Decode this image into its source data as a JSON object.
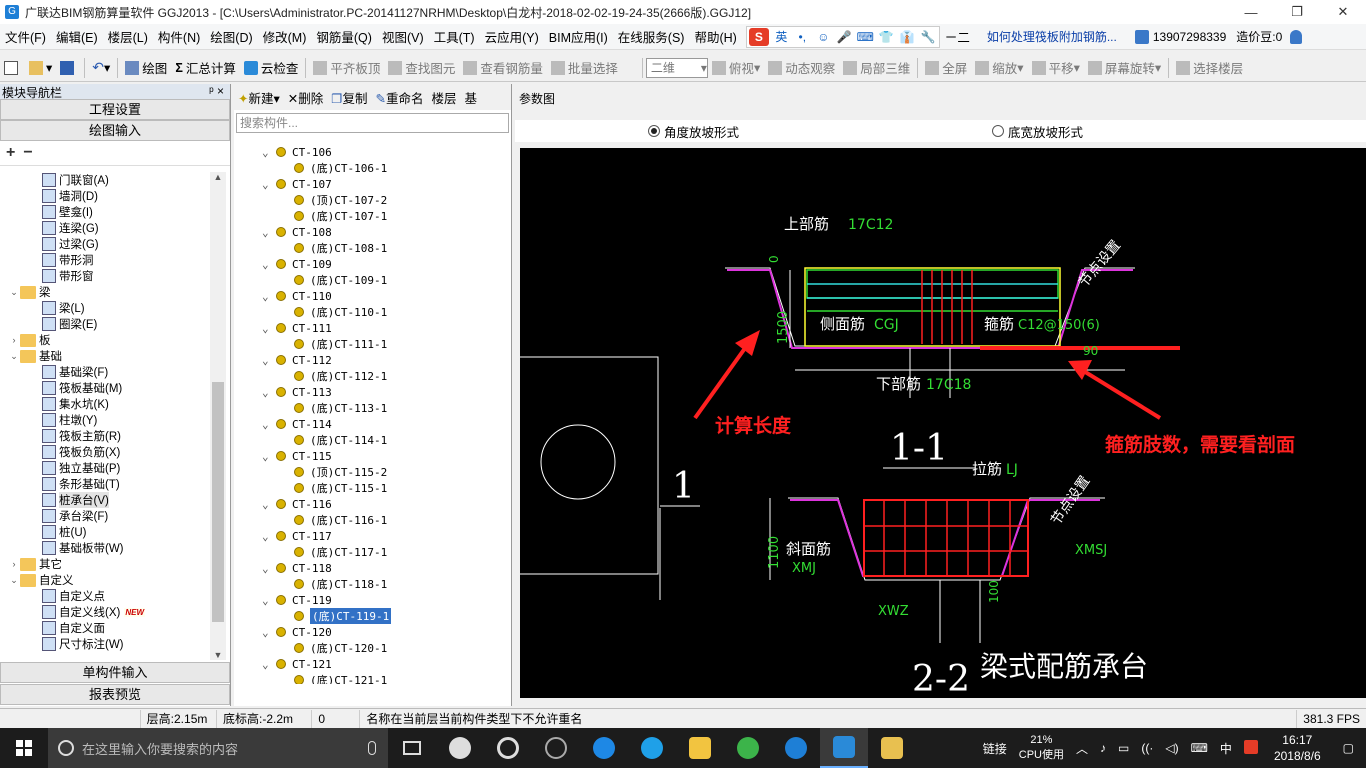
{
  "window": {
    "title": "广联达BIM钢筋算量软件 GGJ2013 - [C:\\Users\\Administrator.PC-20141127NRHM\\Desktop\\白龙村-2018-02-02-19-24-35(2666版).GGJ12]",
    "minimize": "—",
    "maximize": "❐",
    "close": "✕"
  },
  "menu": {
    "items": [
      "文件(F)",
      "编辑(E)",
      "楼层(L)",
      "构件(N)",
      "绘图(D)",
      "修改(M)",
      "钢筋量(Q)",
      "视图(V)",
      "工具(T)",
      "云应用(Y)",
      "BIM应用(I)",
      "在线服务(S)",
      "帮助(H)"
    ],
    "ime": [
      "S",
      "英",
      "•,",
      "☺",
      "🎤",
      "⌨",
      "👕",
      "👔",
      "🔧"
    ],
    "ime_tail": "ㄧ二",
    "help_link": "如何处理筏板附加钢筋...",
    "phone": "13907298339",
    "beans": "造价豆:0"
  },
  "toolbar": {
    "items": [
      {
        "label": "绘图",
        "icon": "draw-icon",
        "enabled": true
      },
      {
        "label": "汇总计算",
        "icon": "sigma-icon",
        "enabled": true
      },
      {
        "label": "云检查",
        "icon": "cloud-check-icon",
        "enabled": true
      },
      {
        "label": "平齐板顶",
        "icon": "align-top-icon",
        "enabled": false
      },
      {
        "label": "查找图元",
        "icon": "find-icon",
        "enabled": false
      },
      {
        "label": "查看钢筋量",
        "icon": "rebar-icon",
        "enabled": false
      },
      {
        "label": "批量选择",
        "icon": "batch-select-icon",
        "enabled": false
      }
    ],
    "view_mode": "二维",
    "view_items": [
      {
        "label": "俯视",
        "icon": "top-view-icon"
      },
      {
        "label": "动态观察",
        "icon": "orbit-icon"
      },
      {
        "label": "局部三维",
        "icon": "local-3d-icon"
      },
      {
        "label": "全屏",
        "icon": "fullscreen-icon"
      },
      {
        "label": "缩放",
        "icon": "zoom-icon"
      },
      {
        "label": "平移",
        "icon": "pan-icon"
      },
      {
        "label": "屏幕旋转",
        "icon": "rotate-icon"
      },
      {
        "label": "选择楼层",
        "icon": "floor-select-icon"
      }
    ]
  },
  "nav": {
    "title": "模块导航栏",
    "pin": "ᵖ ×",
    "btn_project": "工程设置",
    "btn_draw": "绘图输入",
    "expand_all": "+",
    "collapse_all": "−",
    "tree": [
      {
        "label": "门联窗(A)",
        "level": 2,
        "type": "item"
      },
      {
        "label": "墙洞(D)",
        "level": 2,
        "type": "item"
      },
      {
        "label": "壁龛(I)",
        "level": 2,
        "type": "item"
      },
      {
        "label": "连梁(G)",
        "level": 2,
        "type": "item"
      },
      {
        "label": "过梁(G)",
        "level": 2,
        "type": "item"
      },
      {
        "label": "带形洞",
        "level": 2,
        "type": "item"
      },
      {
        "label": "带形窗",
        "level": 2,
        "type": "item"
      },
      {
        "label": "梁",
        "level": 1,
        "type": "folder",
        "exp": "⌄"
      },
      {
        "label": "梁(L)",
        "level": 2,
        "type": "item"
      },
      {
        "label": "圈梁(E)",
        "level": 2,
        "type": "item"
      },
      {
        "label": "板",
        "level": 1,
        "type": "folder",
        "exp": "›"
      },
      {
        "label": "基础",
        "level": 1,
        "type": "folder",
        "exp": "⌄"
      },
      {
        "label": "基础梁(F)",
        "level": 2,
        "type": "item"
      },
      {
        "label": "筏板基础(M)",
        "level": 2,
        "type": "item"
      },
      {
        "label": "集水坑(K)",
        "level": 2,
        "type": "item"
      },
      {
        "label": "柱墩(Y)",
        "level": 2,
        "type": "item"
      },
      {
        "label": "筏板主筋(R)",
        "level": 2,
        "type": "item"
      },
      {
        "label": "筏板负筋(X)",
        "level": 2,
        "type": "item"
      },
      {
        "label": "独立基础(P)",
        "level": 2,
        "type": "item"
      },
      {
        "label": "条形基础(T)",
        "level": 2,
        "type": "item"
      },
      {
        "label": "桩承台(V)",
        "level": 2,
        "type": "item",
        "selected": true
      },
      {
        "label": "承台梁(F)",
        "level": 2,
        "type": "item"
      },
      {
        "label": "桩(U)",
        "level": 2,
        "type": "item"
      },
      {
        "label": "基础板带(W)",
        "level": 2,
        "type": "item"
      },
      {
        "label": "其它",
        "level": 1,
        "type": "folder",
        "exp": "›"
      },
      {
        "label": "自定义",
        "level": 1,
        "type": "folder",
        "exp": "⌄"
      },
      {
        "label": "自定义点",
        "level": 2,
        "type": "item"
      },
      {
        "label": "自定义线(X)",
        "level": 2,
        "type": "item",
        "badge": "NEW"
      },
      {
        "label": "自定义面",
        "level": 2,
        "type": "item"
      },
      {
        "label": "尺寸标注(W)",
        "level": 2,
        "type": "item"
      }
    ],
    "btn_single": "单构件输入",
    "btn_report": "报表预览"
  },
  "components": {
    "toolbar": [
      "新建",
      "删除",
      "复制",
      "重命名",
      "楼层",
      "基"
    ],
    "search_placeholder": "搜索构件...",
    "list": [
      {
        "label": "CT-106",
        "type": "parent"
      },
      {
        "label": "(底)CT-106-1",
        "type": "child"
      },
      {
        "label": "CT-107",
        "type": "parent"
      },
      {
        "label": "(顶)CT-107-2",
        "type": "child"
      },
      {
        "label": "(底)CT-107-1",
        "type": "child"
      },
      {
        "label": "CT-108",
        "type": "parent"
      },
      {
        "label": "(底)CT-108-1",
        "type": "child"
      },
      {
        "label": "CT-109",
        "type": "parent"
      },
      {
        "label": "(底)CT-109-1",
        "type": "child"
      },
      {
        "label": "CT-110",
        "type": "parent"
      },
      {
        "label": "(底)CT-110-1",
        "type": "child"
      },
      {
        "label": "CT-111",
        "type": "parent"
      },
      {
        "label": "(底)CT-111-1",
        "type": "child"
      },
      {
        "label": "CT-112",
        "type": "parent"
      },
      {
        "label": "(底)CT-112-1",
        "type": "child"
      },
      {
        "label": "CT-113",
        "type": "parent"
      },
      {
        "label": "(底)CT-113-1",
        "type": "child"
      },
      {
        "label": "CT-114",
        "type": "parent"
      },
      {
        "label": "(底)CT-114-1",
        "type": "child"
      },
      {
        "label": "CT-115",
        "type": "parent"
      },
      {
        "label": "(顶)CT-115-2",
        "type": "child"
      },
      {
        "label": "(底)CT-115-1",
        "type": "child"
      },
      {
        "label": "CT-116",
        "type": "parent"
      },
      {
        "label": "(底)CT-116-1",
        "type": "child"
      },
      {
        "label": "CT-117",
        "type": "parent"
      },
      {
        "label": "(底)CT-117-1",
        "type": "child"
      },
      {
        "label": "CT-118",
        "type": "parent"
      },
      {
        "label": "(底)CT-118-1",
        "type": "child"
      },
      {
        "label": "CT-119",
        "type": "parent"
      },
      {
        "label": "(底)CT-119-1",
        "type": "child",
        "selected": true
      },
      {
        "label": "CT-120",
        "type": "parent"
      },
      {
        "label": "(底)CT-120-1",
        "type": "child"
      },
      {
        "label": "CT-121",
        "type": "parent"
      },
      {
        "label": "(底)CT-121-1",
        "type": "child"
      }
    ]
  },
  "param": {
    "title": "参数图",
    "radio_angle": "角度放坡形式",
    "radio_width": "底宽放坡形式",
    "selected": "angle"
  },
  "cad": {
    "s1_top": "上部筋",
    "s1_top_val": "17C12",
    "s1_node": "节点设置",
    "s1_zero": "0",
    "s1_side": "侧面筋",
    "s1_side_val": "CGJ",
    "s1_stirrup": "箍筋",
    "s1_stirrup_val": "C12@150(6)",
    "s1_height": "1500",
    "s1_angle": "90",
    "s1_bottom": "下部筋",
    "s1_bottom_val": "17C18",
    "s1_label": "1-1",
    "plan_label": "1",
    "note_length": "计算长度",
    "note_legs": "箍筋肢数，需要看剖面",
    "s2_tie": "拉筋",
    "s2_tie_val": "LJ",
    "s2_node": "节点设置",
    "s2_slope": "斜面筋",
    "s2_slope_val": "XMJ",
    "s2_xmsj": "XMSJ",
    "s2_height": "1100",
    "s2_xwz": "XWZ",
    "s2_hundred": "100",
    "s2_label": "2-2",
    "title": "梁式配筋承台"
  },
  "status": {
    "floor_height": "层高:2.15m",
    "base_height": "底标高:-2.2m",
    "zero": "0",
    "message": "名称在当前层当前构件类型下不允许重名",
    "fps": "381.3 FPS"
  },
  "taskbar": {
    "search_placeholder": "在这里输入你要搜索的内容",
    "link": "链接",
    "cpu_pct": "21%",
    "cpu_label": "CPU使用",
    "lang": "中",
    "time": "16:17",
    "date": "2018/8/6"
  },
  "colors": {
    "cad_bg": "#000000",
    "rebar_red": "#ff2020",
    "rebar_green": "#33dd33",
    "rebar_magenta": "#dd33dd",
    "rebar_cyan": "#33dddd",
    "rebar_yellow": "#ffff33"
  }
}
